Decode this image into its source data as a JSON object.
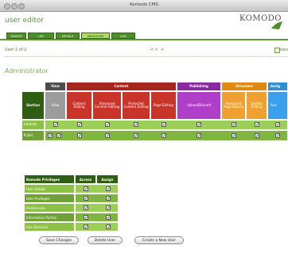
{
  "window": {
    "title": "Komodo CMS"
  },
  "app": {
    "title": "user editor",
    "logo": "KOMODO"
  },
  "tabs": [
    "SEARCH",
    "LIST",
    "DETAILS",
    "PRIVILEGES",
    "LOG"
  ],
  "nav": {
    "user_of": "User 2 of 2",
    "pager": "<< <",
    "close_label": "clos"
  },
  "user": {
    "name": "Administrator"
  },
  "colors": {
    "view": "#4d4d4d",
    "content": "#a5261d",
    "publishing": "#8a2aa0",
    "structure": "#e08a12",
    "assign": "#2f8ed6",
    "green_dark": "#2d5e12",
    "green_row": "#8cc048"
  },
  "priv_table": {
    "groups": {
      "view": "View",
      "content": "Content",
      "publishing": "Publishing",
      "structure": "Structure",
      "assign": "Assig"
    },
    "section_label": "Section",
    "columns": {
      "view": "View",
      "content_editing": "Content Editing",
      "advanced_content_editing": "Advanced Content Editing",
      "protected_content_editing": "Protected Content Editing",
      "page_editing": "Page Editing",
      "upload_discard": "Upload/Discard",
      "advanced_page_editing": "Advanced Page Editing",
      "section_editing": "Section Editing",
      "assign": "Assi"
    },
    "rows": [
      {
        "label": "Intranet",
        "checks": [
          true,
          true,
          true,
          true,
          true,
          true,
          true,
          true,
          true
        ]
      },
      {
        "label": "Public",
        "checks": [
          true,
          true,
          true,
          true,
          true,
          true,
          true,
          true,
          true
        ]
      }
    ]
  },
  "komodo_table": {
    "header": {
      "name": "Komodo Privileges",
      "access": "Access",
      "assign": "Assign"
    },
    "rows": [
      {
        "label": "User Details",
        "access": true,
        "assign": true
      },
      {
        "label": "User Privileges",
        "access": true,
        "assign": true
      },
      {
        "label": "Preferences",
        "access": true,
        "assign": true
      },
      {
        "label": "Information Portals",
        "access": true,
        "assign": true
      },
      {
        "label": "Site Statistics",
        "access": true,
        "assign": true
      }
    ]
  },
  "buttons": {
    "save": "Save Changes",
    "delete": "Delete User",
    "create": "Create a New User"
  }
}
